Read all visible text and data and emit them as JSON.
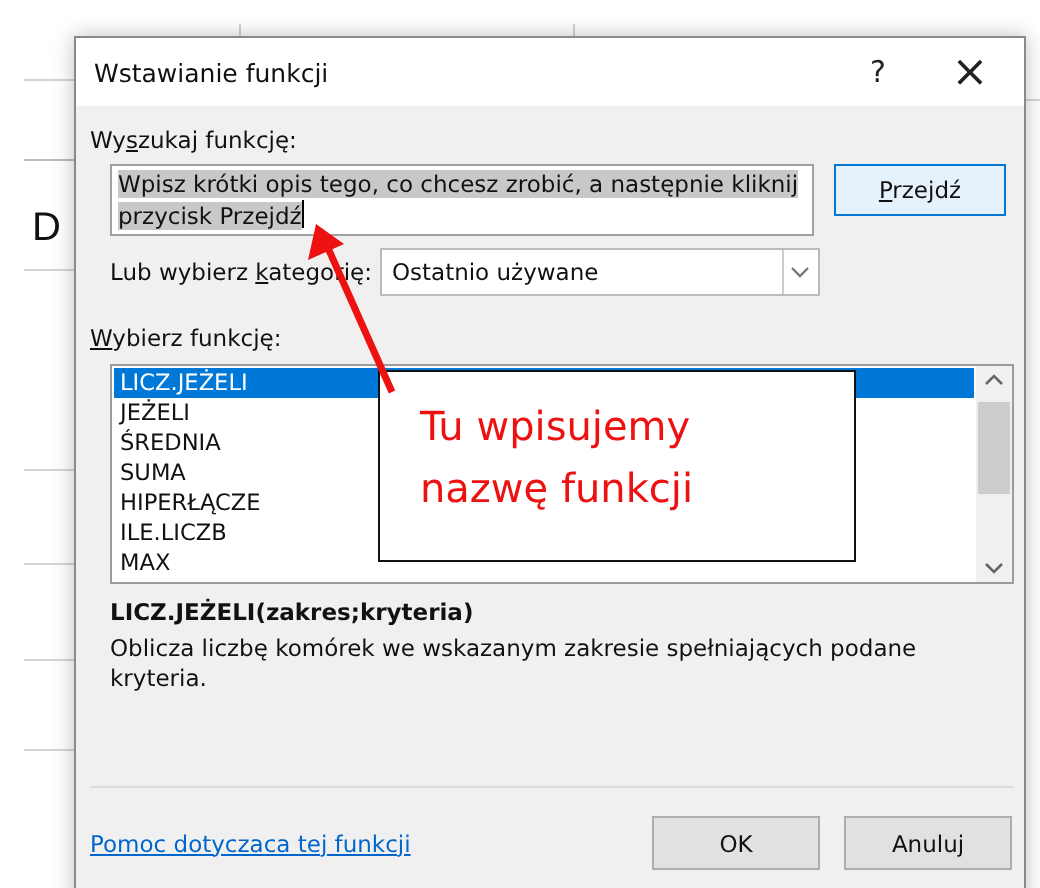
{
  "background_cell_text": "D",
  "window": {
    "title": "Wstawianie funkcji",
    "help": "?",
    "close": "×"
  },
  "search": {
    "label": {
      "pre": "Wy",
      "key": "s",
      "post": "zukaj funkcję:"
    },
    "value": "Wpisz krótki opis tego, co chcesz zrobić, a następnie kliknij przycisk Przejdź",
    "button": {
      "key": "P",
      "post": "rzejdź"
    }
  },
  "category": {
    "label": {
      "pre": "Lub wybierz ",
      "key": "k",
      "post": "ategorię:"
    },
    "value": "Ostatnio używane"
  },
  "functions": {
    "label": {
      "key": "W",
      "post": "ybierz funkcję:"
    },
    "items": [
      {
        "name": "LICZ.JEŻELI",
        "selected": true
      },
      {
        "name": "JEŻELI",
        "selected": false
      },
      {
        "name": "ŚREDNIA",
        "selected": false
      },
      {
        "name": "SUMA",
        "selected": false
      },
      {
        "name": "HIPERŁĄCZE",
        "selected": false
      },
      {
        "name": "ILE.LICZB",
        "selected": false
      },
      {
        "name": "MAX",
        "selected": false
      }
    ]
  },
  "signature": "LICZ.JEŻELI(zakres;kryteria)",
  "description": "Oblicza liczbę komórek we wskazanym zakresie spełniających podane kryteria.",
  "help_link": "Pomoc dotyczaca tej funkcji",
  "buttons": [
    "OK",
    "Anuluj"
  ],
  "callout": {
    "text": "Tu wpisujemy nazwę funkcji"
  }
}
